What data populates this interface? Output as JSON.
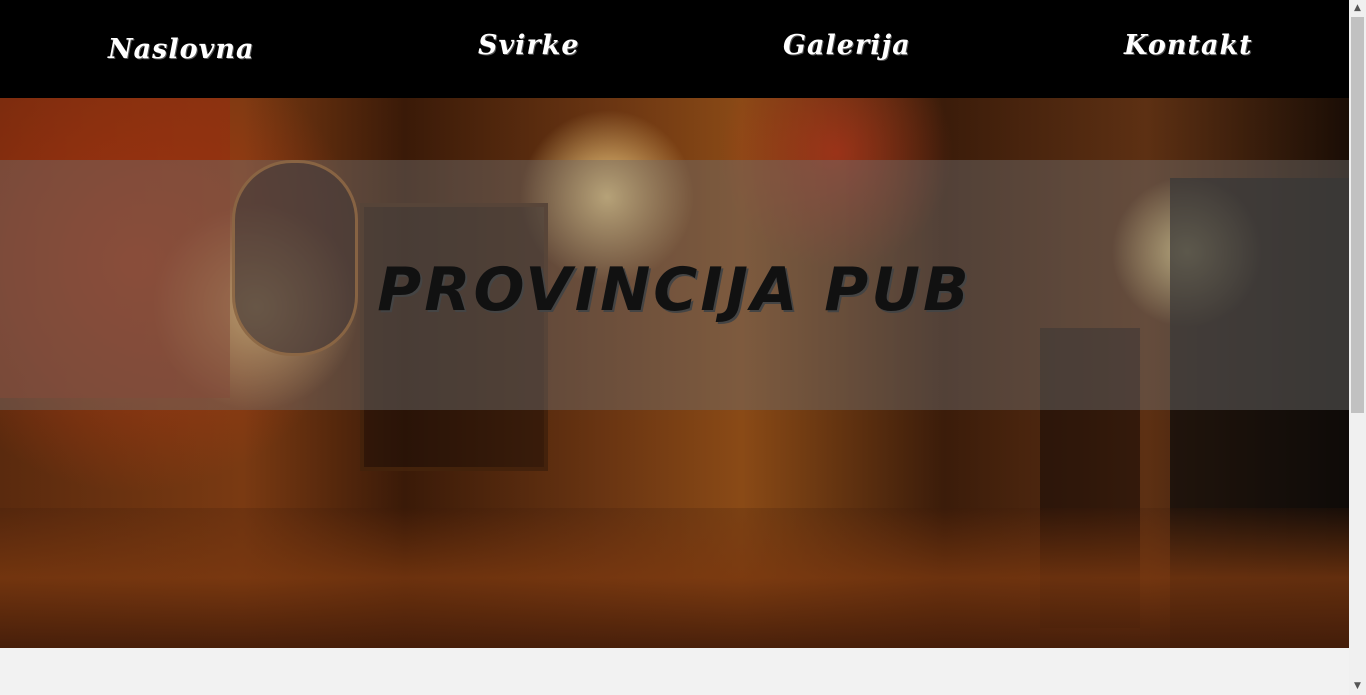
{
  "nav": {
    "items": [
      {
        "label": "Naslovna"
      },
      {
        "label": "Svirke"
      },
      {
        "label": "Galerija"
      },
      {
        "label": "Kontakt"
      }
    ]
  },
  "hero": {
    "title": "PROVINCIJA PUB"
  },
  "colors": {
    "nav_background": "#000000",
    "nav_text": "#ffffff",
    "title_text": "#111111"
  }
}
